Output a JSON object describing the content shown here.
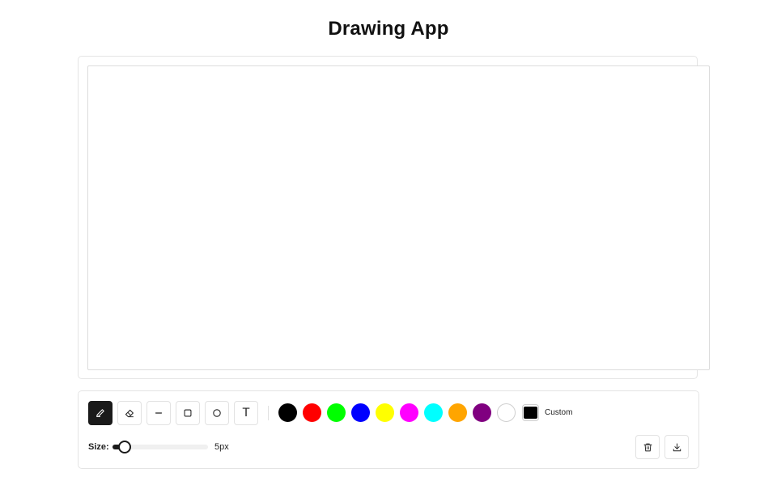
{
  "app": {
    "title": "Drawing App"
  },
  "tools": [
    {
      "name": "pen",
      "icon": "pencil-icon",
      "active": true
    },
    {
      "name": "eraser",
      "icon": "eraser-icon",
      "active": false
    },
    {
      "name": "line",
      "icon": "line-icon",
      "active": false
    },
    {
      "name": "rectangle",
      "icon": "square-icon",
      "active": false
    },
    {
      "name": "circle",
      "icon": "circle-icon",
      "active": false
    },
    {
      "name": "text",
      "icon": "text-icon",
      "glyph": "T",
      "active": false
    }
  ],
  "palette": {
    "colors": [
      "#000000",
      "#ff0000",
      "#00ff00",
      "#0000ff",
      "#ffff00",
      "#ff00ff",
      "#00ffff",
      "#ffa500",
      "#800080",
      "#ffffff"
    ],
    "selected": "#000000",
    "custom_color": "#000000",
    "custom_label": "Custom"
  },
  "brush": {
    "size_label": "Size:",
    "size_value": "5px",
    "size_fraction": 0.13
  },
  "actions": [
    {
      "name": "clear",
      "icon": "trash-icon"
    },
    {
      "name": "download",
      "icon": "download-icon"
    }
  ],
  "theme": {
    "accent": "#1a1a1a",
    "border": "#e4e4e4"
  }
}
